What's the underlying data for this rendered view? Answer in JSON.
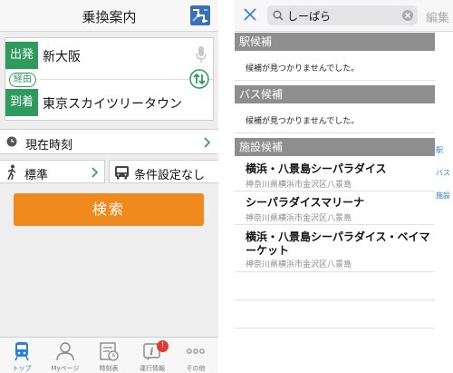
{
  "left": {
    "title": "乗換案内",
    "departure_tag": "出発",
    "arrival_tag": "到着",
    "via_tag": "経由",
    "departure_station": "新大阪",
    "arrival_station": "東京スカイツリータウン",
    "time_label": "現在時刻",
    "speed_label": "標準",
    "conditions_label": "条件設定なし",
    "search_button": "検索",
    "tabs": [
      {
        "label": "トップ",
        "icon": "train-icon"
      },
      {
        "label": "Myページ",
        "icon": "person-icon"
      },
      {
        "label": "時刻表",
        "icon": "timetable-icon"
      },
      {
        "label": "運行情報",
        "icon": "info-icon",
        "badge": "!"
      },
      {
        "label": "その他",
        "icon": "more-icon"
      }
    ]
  },
  "right": {
    "search_value": "しーぱら",
    "edit_label": "編集",
    "sections": {
      "station": {
        "header": "駅候補",
        "empty": "候補が見つかりませんでした。"
      },
      "bus": {
        "header": "バス候補",
        "empty": "候補が見つかりませんでした。"
      },
      "facility": {
        "header": "施設候補"
      }
    },
    "facilities": [
      {
        "name": "横浜・八景島シーパラダイス",
        "address": "神奈川県横浜市金沢区八景島"
      },
      {
        "name": "シーパラダイスマリーナ",
        "address": "神奈川県横浜市金沢区八景島"
      },
      {
        "name": "横浜・八景島シーパラダイス・ベイマーケット",
        "address": "神奈川県横浜市金沢区八景島"
      }
    ],
    "index": [
      "駅",
      "バス",
      "施設"
    ]
  },
  "colors": {
    "accent_green": "#2e9a5e",
    "search_orange": "#f08a1c",
    "section_gray": "#8e8e8e",
    "link_blue": "#2a7fd6"
  }
}
